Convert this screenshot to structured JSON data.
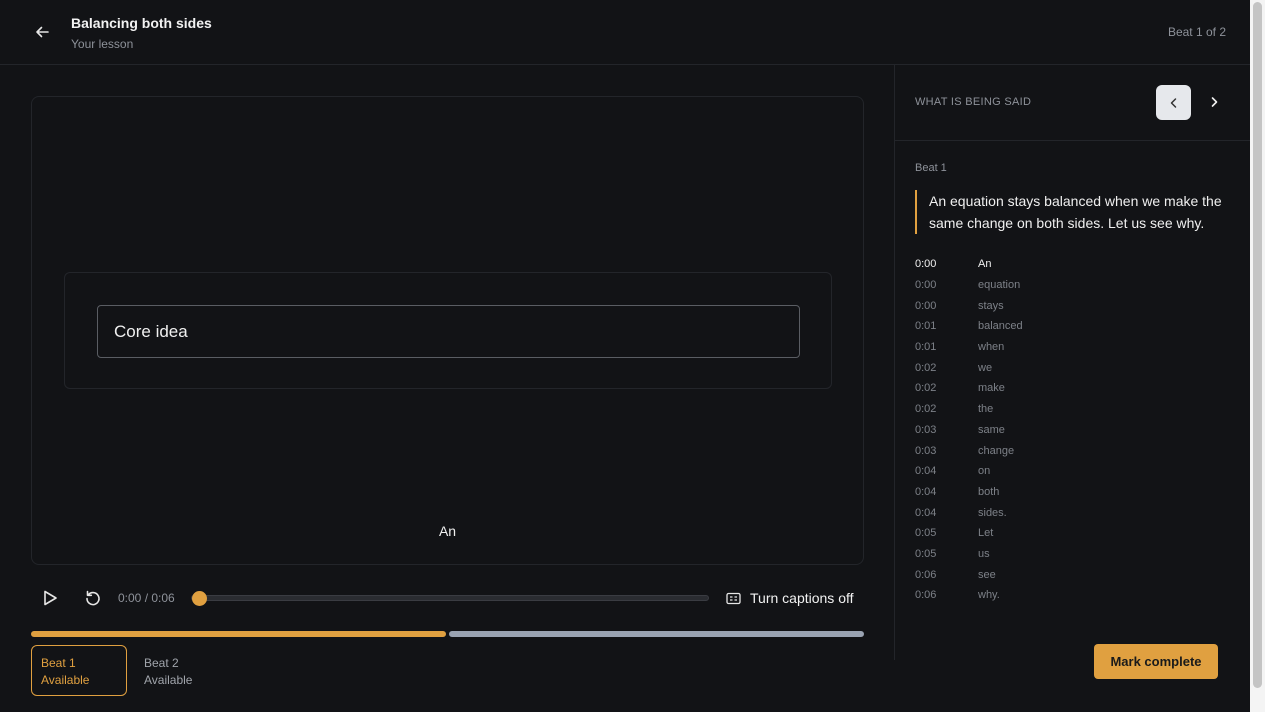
{
  "header": {
    "title": "Balancing both sides",
    "subtitle": "Your lesson",
    "beat_counter": "Beat 1 of 2"
  },
  "stage": {
    "card_label": "Core idea",
    "live_caption": "An"
  },
  "player": {
    "time": "0:00 / 0:06",
    "progress": 0,
    "captions_label": "Turn captions off"
  },
  "beats": [
    {
      "name": "Beat 1",
      "status": "Available"
    },
    {
      "name": "Beat 2",
      "status": "Available"
    }
  ],
  "sidebar": {
    "title": "WHAT IS BEING SAID",
    "beat_label": "Beat 1",
    "quote": "An equation stays balanced when we make the same change on both sides. Let us see why.",
    "words": [
      {
        "t": "0:00",
        "w": "An"
      },
      {
        "t": "0:00",
        "w": "equation"
      },
      {
        "t": "0:00",
        "w": "stays"
      },
      {
        "t": "0:01",
        "w": "balanced"
      },
      {
        "t": "0:01",
        "w": "when"
      },
      {
        "t": "0:02",
        "w": "we"
      },
      {
        "t": "0:02",
        "w": "make"
      },
      {
        "t": "0:02",
        "w": "the"
      },
      {
        "t": "0:03",
        "w": "same"
      },
      {
        "t": "0:03",
        "w": "change"
      },
      {
        "t": "0:04",
        "w": "on"
      },
      {
        "t": "0:04",
        "w": "both"
      },
      {
        "t": "0:04",
        "w": "sides."
      },
      {
        "t": "0:05",
        "w": "Let"
      },
      {
        "t": "0:05",
        "w": "us"
      },
      {
        "t": "0:06",
        "w": "see"
      },
      {
        "t": "0:06",
        "w": "why."
      }
    ]
  },
  "actions": {
    "mark_complete": "Mark complete"
  },
  "colors": {
    "accent": "#e0a040",
    "background": "#121316",
    "secondary_progress": "#9aa3b2"
  }
}
